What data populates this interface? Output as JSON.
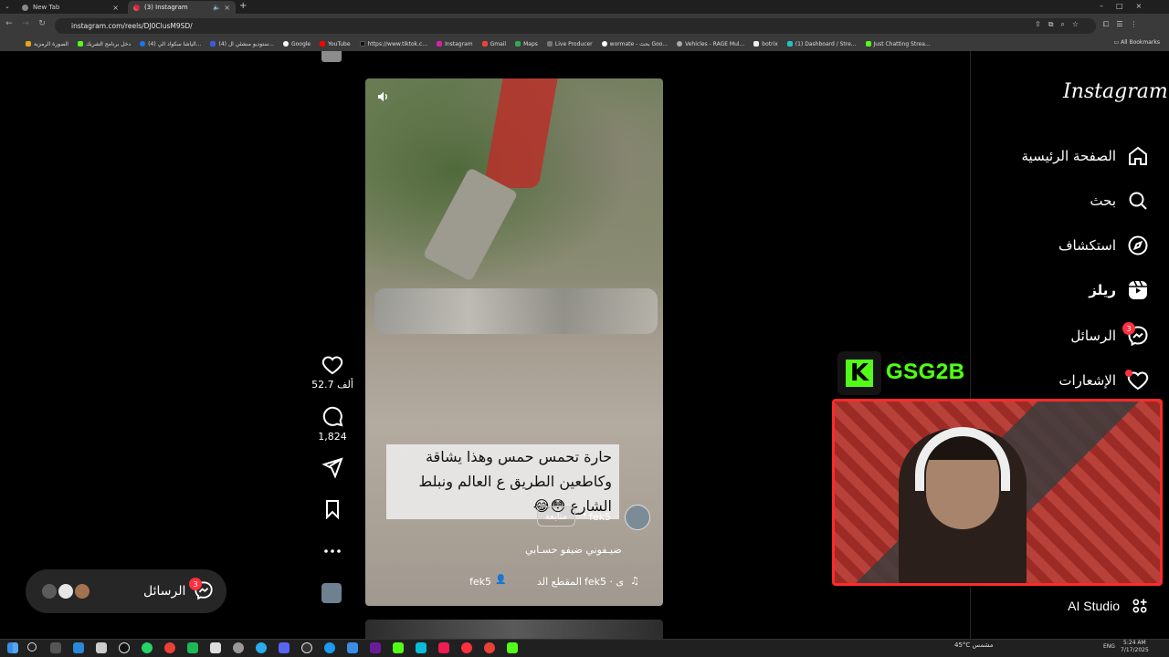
{
  "browser": {
    "tabs": [
      {
        "title": "New Tab",
        "active": false
      },
      {
        "title": "(3) Instagram",
        "active": true
      }
    ],
    "url": "instagram.com/reels/DJ0ClusM9SD/",
    "bookmarks": [
      "الصورة الرمزية",
      "دخل برنامج الشريك",
      "(4) الياشا سكواد الي...",
      "(4) ستوديو منشئي ال...",
      "Google",
      "YouTube",
      "https://www.tiktok.c...",
      "Instagram",
      "Gmail",
      "Maps",
      "Live Producer",
      "wormate - بحث Goo...",
      "Vehicles - RAGE Mul...",
      "botrix",
      "(1) Dashboard / Stre...",
      "Just Chatting Strea..."
    ],
    "all_bookmarks_label": "All Bookmarks"
  },
  "sidebar": {
    "logo": "Instagram",
    "items": [
      {
        "label": "الصفحة الرئيسية",
        "icon": "home-icon"
      },
      {
        "label": "بحث",
        "icon": "search-icon"
      },
      {
        "label": "استكشاف",
        "icon": "compass-icon"
      },
      {
        "label": "ريلز",
        "icon": "reels-icon"
      },
      {
        "label": "الرسائل",
        "icon": "messenger-icon",
        "badge": "3"
      },
      {
        "label": "الإشعارات",
        "icon": "heart-icon"
      }
    ],
    "ai_studio": "AI Studio"
  },
  "reel": {
    "caption": "حارة تحمس حمس وهذا يشاقة وكاطعين الطريق ع العالم ونبلط الشارع 😳😂",
    "author": "fek5",
    "follow_label": "متابعة",
    "dot": "•",
    "description": "ضيـفوني ضيفو حسـابي",
    "audio": "fek5 · ى",
    "tag_user": "fek5",
    "section": "المقطع الد",
    "likes": "52.7 ألف",
    "comments": "1,824"
  },
  "messages_pill": {
    "label": "الرسائل",
    "badge": "3"
  },
  "stream_overlay": {
    "name": "GSG2B",
    "logo_letter": "K"
  },
  "taskbar": {
    "weather": "45°C مشمس",
    "lang": "ENG",
    "time": "5:24 AM",
    "date": "7/17/2025"
  },
  "colors": {
    "kick_green": "#53fc18",
    "badge_red": "#ff3040",
    "webcam_border": "#ff2a2a"
  }
}
